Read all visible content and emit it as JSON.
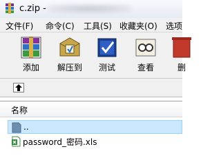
{
  "window": {
    "title": "c.zip -"
  },
  "menu": [
    "文件(F)",
    "命令(C)",
    "工具(S)",
    "收藏夹(O)",
    "选项"
  ],
  "toolbar": [
    {
      "label": "添加",
      "icon": "add-archive-icon"
    },
    {
      "label": "解压到",
      "icon": "extract-to-icon"
    },
    {
      "label": "测试",
      "icon": "test-archive-icon"
    },
    {
      "label": "查看",
      "icon": "view-icon"
    },
    {
      "label": "删",
      "icon": "delete-icon"
    }
  ],
  "list": {
    "column_name": "名称",
    "rows": [
      {
        "name": "..",
        "icon": "parent-folder-icon",
        "selected": true
      },
      {
        "name": "password_密码.xls",
        "icon": "excel-file-icon",
        "selected": false
      }
    ]
  },
  "colors": {
    "selection": "#cce8ff",
    "selection_border": "#99d1ff"
  }
}
